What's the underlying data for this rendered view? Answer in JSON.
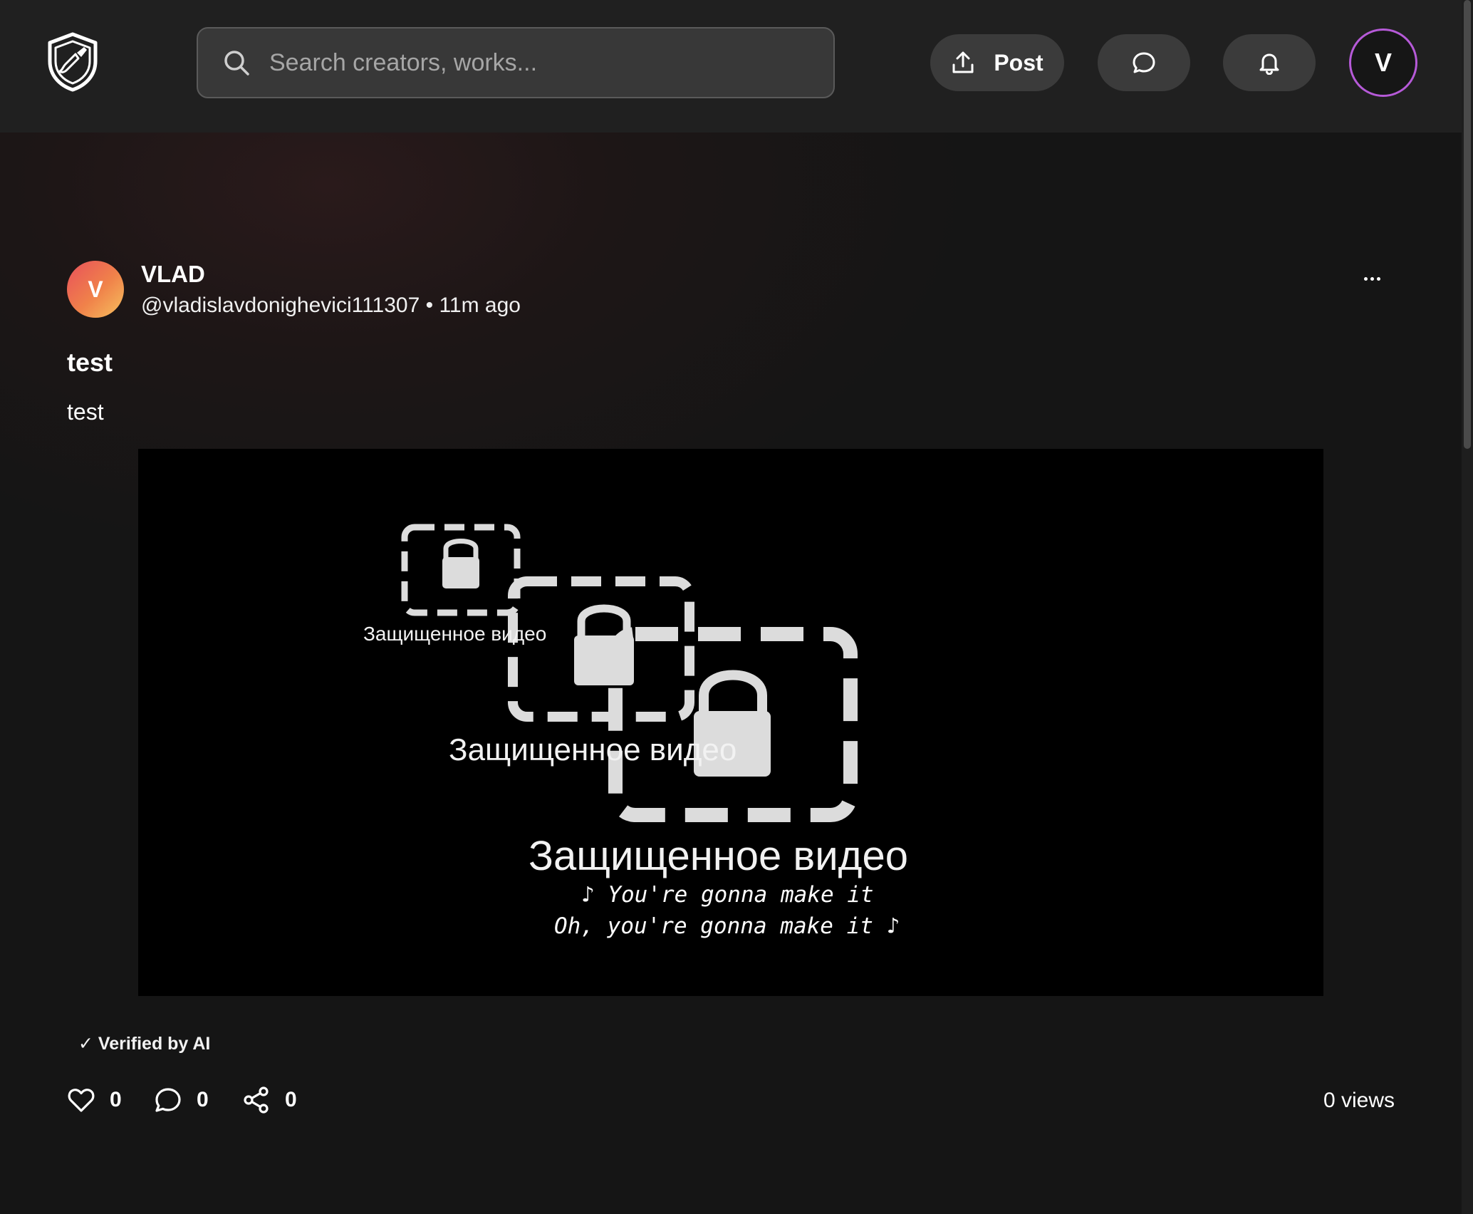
{
  "header": {
    "logo_icon": "shield-brush-icon",
    "search_placeholder": "Search creators, works...",
    "post_label": "Post",
    "message_icon": "chat-bubble-icon",
    "notification_icon": "bell-icon",
    "user_initial": "V"
  },
  "post": {
    "author_initial": "V",
    "author_name": "VLAD",
    "author_handle": "@vladislavdonighevici111307",
    "separator": "•",
    "time_ago": "11m ago",
    "title": "test",
    "body": "test",
    "video": {
      "protected_label_small": "Защищенное видео",
      "protected_label_medium": "Защищенное видео",
      "protected_label_large": "Защищенное видео",
      "lyrics_line_1": "♪ You're gonna make it",
      "lyrics_line_2": "Oh, you're gonna make it ♪"
    },
    "verified_label": "✓ Verified by AI",
    "likes": "0",
    "comments": "0",
    "shares": "0",
    "views": "0 views"
  },
  "colors": {
    "accent_ring": "#b65ad8",
    "avatar_gradient_start": "#e8505b",
    "avatar_gradient_end": "#f6c15e"
  }
}
